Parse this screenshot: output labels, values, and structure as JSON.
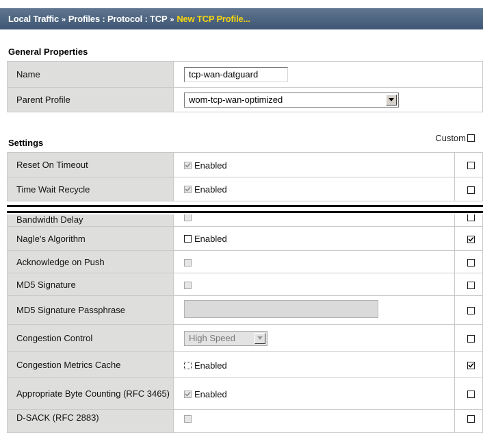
{
  "breadcrumb": {
    "part1": "Local Traffic",
    "sep": "»",
    "part2": "Profiles : Protocol : TCP",
    "current": "New TCP Profile..."
  },
  "general": {
    "title": "General Properties",
    "name_label": "Name",
    "name_value": "tcp-wan-datguard",
    "parent_label": "Parent Profile",
    "parent_value": "wom-tcp-wan-optimized"
  },
  "settings": {
    "title": "Settings",
    "custom_label": "Custom",
    "rows": [
      {
        "label": "Reset On Timeout",
        "enabled_checked": true,
        "enabled_disabled": true,
        "enabled_text": "Enabled",
        "custom_checked": false
      },
      {
        "label": "Time Wait Recycle",
        "enabled_checked": true,
        "enabled_disabled": true,
        "enabled_text": "Enabled",
        "custom_checked": false
      },
      {
        "label": "Bandwidth Delay",
        "enabled_checked": false,
        "enabled_disabled": true,
        "enabled_text": "",
        "custom_checked": false
      },
      {
        "label": "Nagle's Algorithm",
        "enabled_checked": false,
        "enabled_disabled": false,
        "enabled_text": "Enabled",
        "custom_checked": true
      },
      {
        "label": "Acknowledge on Push",
        "enabled_checked": false,
        "enabled_disabled": true,
        "enabled_text": "",
        "custom_checked": false
      },
      {
        "label": "MD5 Signature",
        "enabled_checked": false,
        "enabled_disabled": true,
        "enabled_text": "",
        "custom_checked": false
      },
      {
        "label": "MD5 Signature Passphrase",
        "custom_checked": false
      },
      {
        "label": "Congestion Control",
        "select_value": "High Speed",
        "custom_checked": false
      },
      {
        "label": "Congestion Metrics Cache",
        "enabled_checked": false,
        "enabled_disabled": false,
        "focused": true,
        "enabled_text": "Enabled",
        "custom_checked": true
      },
      {
        "label": "Appropriate Byte Counting (RFC 3465)",
        "enabled_checked": true,
        "enabled_disabled": true,
        "enabled_text": "Enabled",
        "custom_checked": false
      },
      {
        "label": "D-SACK (RFC 2883)",
        "enabled_checked": false,
        "enabled_disabled": true,
        "enabled_text": "",
        "custom_checked": false
      }
    ]
  }
}
